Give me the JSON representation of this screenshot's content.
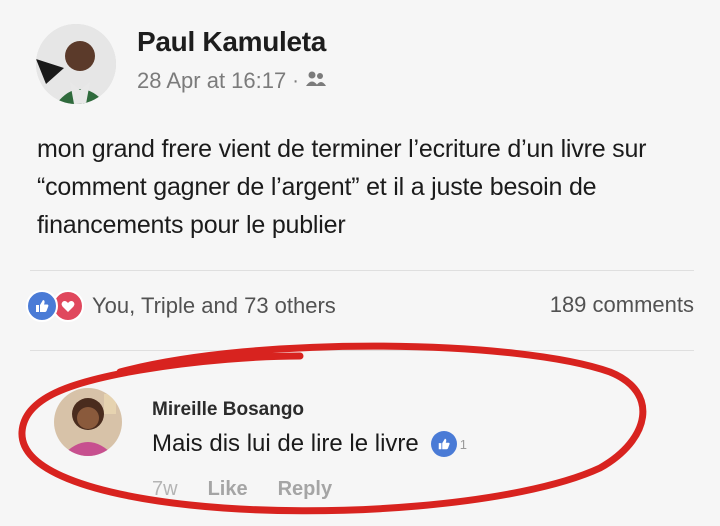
{
  "post": {
    "author": "Paul Kamuleta",
    "timestamp": "28 Apr at 16:17",
    "privacy_icon": "friends-icon",
    "text": "mon grand frere vient de terminer l’ecriture d’un livre sur “comment gagner de l’argent” et il a juste besoin de financements pour le publier",
    "reactions_summary": "You, Triple and 73 others",
    "reaction_icons": [
      "like-icon",
      "love-icon"
    ],
    "comments_count": "189 comments"
  },
  "comment": {
    "author": "Mireille Bosango",
    "text": "Mais dis lui de lire le livre",
    "like_count": "1",
    "time": "7w",
    "like_label": "Like",
    "reply_label": "Reply"
  },
  "colors": {
    "like_blue": "#4a7bd6",
    "love_red": "#e0485d",
    "circle_red": "#d8231f",
    "meta_gray": "#7b7b7b"
  }
}
